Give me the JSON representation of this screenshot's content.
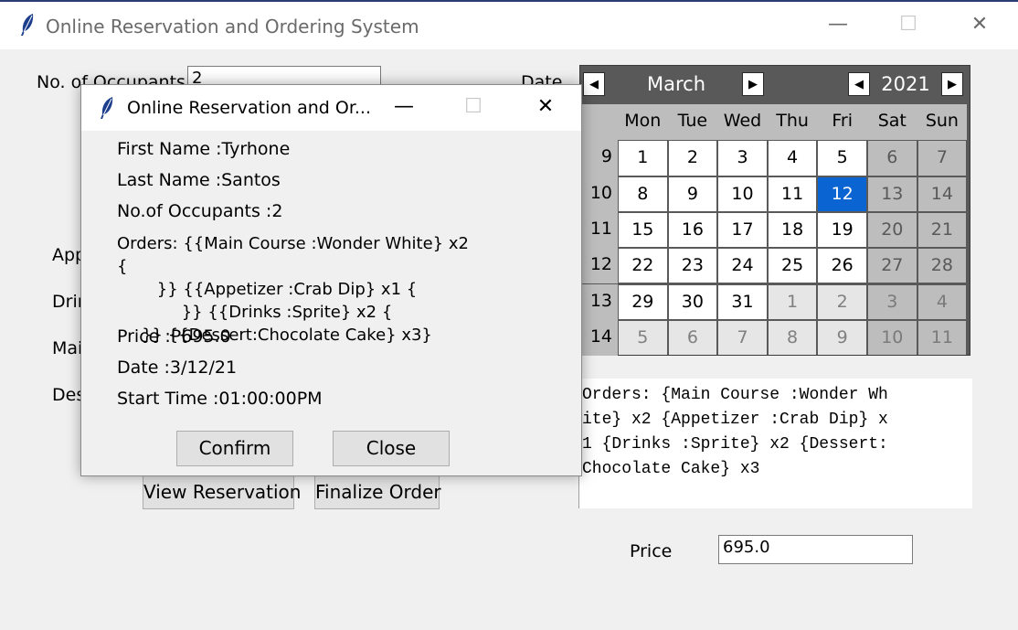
{
  "main_window": {
    "title": "Online Reservation and Ordering System",
    "controls": {
      "minimize": "—",
      "maximize": "☐",
      "close": "✕"
    },
    "labels": {
      "occupants": "No. of Occupants",
      "date": "Date",
      "appetizer_partial": "App",
      "drinks_partial": "Drir",
      "main_partial": "Mai",
      "dessert_partial": "Des",
      "price": "Price"
    },
    "occupants_value": "2",
    "price_value": "695.0",
    "buttons": {
      "view_reservation": "View Reservation",
      "finalize_order": "Finalize Order"
    },
    "orders_text": "Orders: {Main Course :Wonder Wh\nite} x2 {Appetizer :Crab Dip} x\n1 {Drinks :Sprite} x2 {Dessert:\nChocolate Cake} x3"
  },
  "calendar": {
    "month": "March",
    "year": "2021",
    "prev_month": "◀",
    "next_month": "▶",
    "prev_year": "◀",
    "next_year": "▶",
    "day_headers": [
      "Mon",
      "Tue",
      "Wed",
      "Thu",
      "Fri",
      "Sat",
      "Sun"
    ],
    "weeks": [
      {
        "num": "9",
        "days": [
          "1",
          "2",
          "3",
          "4",
          "5",
          "6",
          "7"
        ]
      },
      {
        "num": "10",
        "days": [
          "8",
          "9",
          "10",
          "11",
          "12",
          "13",
          "14"
        ]
      },
      {
        "num": "11",
        "days": [
          "15",
          "16",
          "17",
          "18",
          "19",
          "20",
          "21"
        ]
      },
      {
        "num": "12",
        "days": [
          "22",
          "23",
          "24",
          "25",
          "26",
          "27",
          "28"
        ]
      },
      {
        "num": "13",
        "days": [
          "29",
          "30",
          "31",
          "1",
          "2",
          "3",
          "4"
        ]
      },
      {
        "num": "14",
        "days": [
          "5",
          "6",
          "7",
          "8",
          "9",
          "10",
          "11"
        ]
      }
    ],
    "selected_day": "12"
  },
  "dialog": {
    "title": "Online Reservation and Or...",
    "controls": {
      "minimize": "—",
      "maximize": "☐",
      "close": "✕"
    },
    "first_name": "First Name :Tyrhone",
    "last_name": "Last Name :Santos",
    "occupants": "No.of Occupants :2",
    "orders_lines": [
      "Orders: {{Main Course :Wonder White} x2 {",
      "}} {{Appetizer :Crab Dip} x1 {",
      "}} {{Drinks :Sprite} x2 {",
      "}} {{Dessert:Chocolate Cake} x3}"
    ],
    "price": "Price :P695.0",
    "date": "Date :3/12/21",
    "start_time": "Start Time :01:00:00PM",
    "buttons": {
      "confirm": "Confirm",
      "close": "Close"
    }
  },
  "colors": {
    "selected_day": "#0a64d2",
    "calendar_header": "#595959",
    "window_border": "#2b3e74"
  },
  "icons": {
    "app_icon": "feather-icon"
  }
}
